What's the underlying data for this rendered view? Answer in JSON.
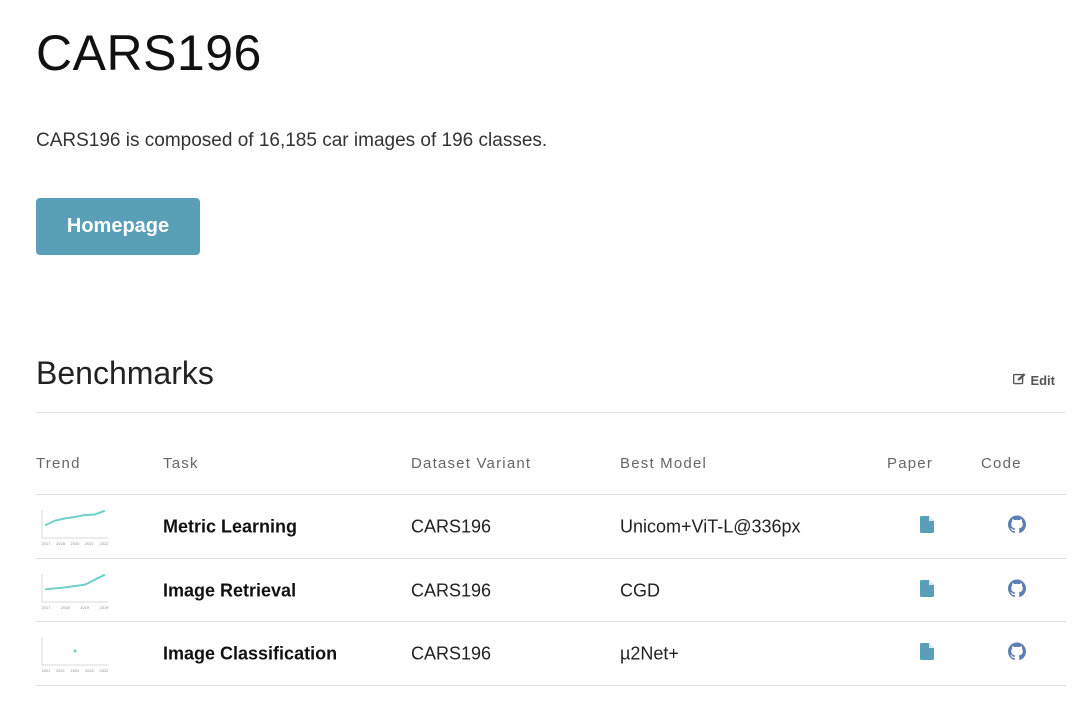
{
  "page": {
    "title": "CARS196",
    "description": "CARS196 is composed of 16,185 car images of 196 classes.",
    "homepage_button": "Homepage"
  },
  "benchmarks": {
    "title": "Benchmarks",
    "edit_label": "Edit",
    "columns": [
      "Trend",
      "Task",
      "Dataset Variant",
      "Best Model",
      "Paper",
      "Code"
    ],
    "rows": [
      {
        "task": "Metric Learning",
        "variant": "CARS196",
        "model": "Unicom+ViT-L@336px",
        "trend": {
          "x": [
            0,
            1,
            2,
            3,
            4,
            5,
            6
          ],
          "y": [
            0.55,
            0.38,
            0.3,
            0.25,
            0.18,
            0.16,
            0.02
          ],
          "x_ticks": [
            "2017",
            "2018",
            "2020",
            "2021",
            "2022"
          ]
        }
      },
      {
        "task": "Image Retrieval",
        "variant": "CARS196",
        "model": "CGD",
        "trend": {
          "x": [
            0,
            1,
            2,
            3
          ],
          "y": [
            0.55,
            0.48,
            0.38,
            0.02
          ],
          "x_ticks": [
            "2017",
            "2018",
            "2019",
            "2019"
          ]
        }
      },
      {
        "task": "Image Classification",
        "variant": "CARS196",
        "model": "µ2Net+",
        "trend": {
          "x": [
            0
          ],
          "y": [
            0.5
          ],
          "x_ticks": [
            "2021",
            "2021",
            "2022",
            "2022",
            "2022"
          ]
        }
      }
    ]
  },
  "colors": {
    "button": "#5a9fb8",
    "paper_icon": "#5a9fb8",
    "code_icon": "#5b7fb5",
    "trend_line": "#6fd0c8"
  }
}
